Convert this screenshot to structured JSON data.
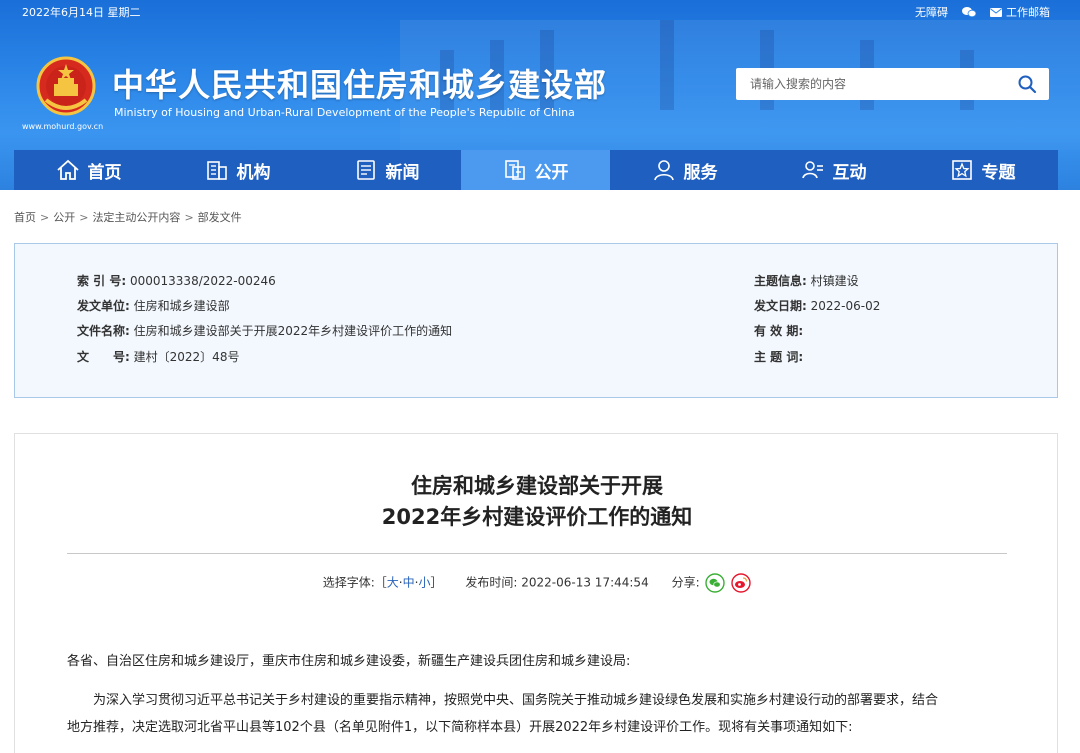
{
  "topbar": {
    "date": "2022年6月14日 星期二",
    "accessibility": "无障碍",
    "mail": "工作邮箱"
  },
  "site": {
    "title": "中华人民共和国住房和城乡建设部",
    "subtitle": "Ministry of Housing and Urban-Rural Development of the People's Republic of China",
    "url": "www.mohurd.gov.cn"
  },
  "search": {
    "placeholder": "请输入搜索的内容"
  },
  "nav": [
    {
      "label": "首页",
      "icon": "home-icon"
    },
    {
      "label": "机构",
      "icon": "building-icon"
    },
    {
      "label": "新闻",
      "icon": "news-icon"
    },
    {
      "label": "公开",
      "icon": "disclosure-icon",
      "active": true
    },
    {
      "label": "服务",
      "icon": "service-icon"
    },
    {
      "label": "互动",
      "icon": "interaction-icon"
    },
    {
      "label": "专题",
      "icon": "topic-icon"
    }
  ],
  "breadcrumb": [
    "首页",
    "公开",
    "法定主动公开内容",
    "部发文件"
  ],
  "meta": {
    "index_key": "索 引 号:",
    "index_val": "000013338/2022-00246",
    "issuer_key": "发文单位:",
    "issuer_val": "住房和城乡建设部",
    "docname_key": "文件名称:",
    "docname_val": "住房和城乡建设部关于开展2022年乡村建设评价工作的通知",
    "docno_key": "文　　号:",
    "docno_val": "建村〔2022〕48号",
    "topic_key": "主题信息:",
    "topic_val": "村镇建设",
    "date_key": "发文日期:",
    "date_val": "2022-06-02",
    "validity_key": "有 效 期:",
    "keywords_key": "主 题 词:"
  },
  "article": {
    "title_line1": "住房和城乡建设部关于开展",
    "title_line2": "2022年乡村建设评价工作的通知",
    "font_label": "选择字体:［",
    "font_large": "大",
    "font_medium": "中",
    "font_small": "小",
    "font_end": "］",
    "publish_label": "发布时间:",
    "publish_time": "2022-06-13 17:44:54",
    "share_label": "分享:",
    "salutation": "各省、自治区住房和城乡建设厅，重庆市住房和城乡建设委，新疆生产建设兵团住房和城乡建设局:",
    "para1_line1": "为深入学习贯彻习近平总书记关于乡村建设的重要指示精神，按照党中央、国务院关于推动城乡建设绿色发展和实施乡村建设行动的部署要求，结合",
    "para1_line2": "地方推荐，决定选取河北省平山县等102个县（名单见附件1，以下简称样本县）开展2022年乡村建设评价工作。现将有关事项通知如下:"
  },
  "colors": {
    "header_blue": "#2b86e8",
    "nav_blue": "#1f5fbf",
    "nav_active": "#4b9af0",
    "meta_bg": "#f3f8fe",
    "meta_border": "#a9c9ea",
    "link_blue": "#2a63b8",
    "wechat_green": "#3aae35",
    "weibo_red": "#e6162d"
  }
}
